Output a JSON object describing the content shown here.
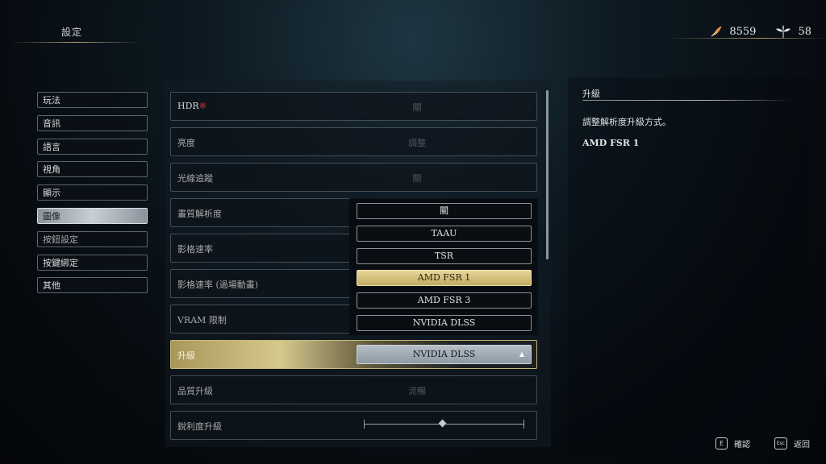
{
  "header": {
    "title": "設定"
  },
  "currency": {
    "feathers": "8559",
    "leaves": "58"
  },
  "menu": {
    "items": [
      {
        "label": "玩法"
      },
      {
        "label": "音訊"
      },
      {
        "label": "語言"
      },
      {
        "label": "視角"
      },
      {
        "label": "顯示"
      },
      {
        "label": "圖像"
      },
      {
        "label": "按鈕設定"
      },
      {
        "label": "按鍵綁定"
      },
      {
        "label": "其他"
      }
    ],
    "active_index": 5
  },
  "settings": {
    "rows": [
      {
        "label": "HDR",
        "marker": "※",
        "value": "關"
      },
      {
        "label": "亮度",
        "value": "調整"
      },
      {
        "label": "光線追蹤",
        "value": "關"
      },
      {
        "label": "畫質解析度",
        "value": ""
      },
      {
        "label": "影格速率",
        "value": ""
      },
      {
        "label": "影格速率 (過場動畫)",
        "value": ""
      },
      {
        "label": "VRAM 限制",
        "value": ""
      },
      {
        "label": "升級",
        "value": "NVIDIA DLSS"
      },
      {
        "label": "品質升級",
        "value": "流暢"
      },
      {
        "label": "銳利度升級",
        "value": ""
      }
    ]
  },
  "dropdown": {
    "options": [
      "關",
      "TAAU",
      "TSR",
      "AMD FSR 1",
      "AMD FSR 3",
      "NVIDIA DLSS"
    ],
    "highlighted": "AMD FSR 1",
    "current": "NVIDIA DLSS"
  },
  "slider": {
    "value_fraction": 0.49
  },
  "info": {
    "title": "升級",
    "description": "調整解析度升級方式。",
    "value": "AMD FSR 1"
  },
  "footer": {
    "confirm_key": "E",
    "confirm_label": "確認",
    "back_key": "Esc",
    "back_label": "返回"
  },
  "colors": {
    "accent_gold": "#c9b978",
    "highlight_option": "#d6c98e",
    "warning_marker": "#d23a3a"
  }
}
